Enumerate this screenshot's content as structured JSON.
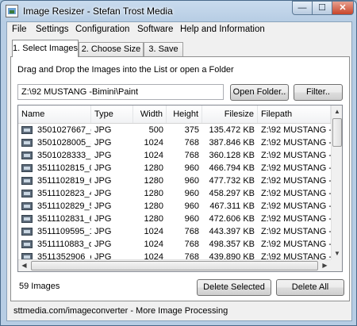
{
  "window": {
    "title": "Image Resizer - Stefan Trost Media",
    "min_glyph": "—",
    "max_glyph": "☐",
    "close_glyph": "✕"
  },
  "menu": [
    "File",
    "Settings",
    "Configuration",
    "Software",
    "Help and Information"
  ],
  "tabs": [
    "1. Select Images",
    "2. Choose Size",
    "3. Save"
  ],
  "hint": "Drag and Drop the Images into the List or open a Folder",
  "folder_path": "Z:\\92 MUSTANG -Bimini\\Paint",
  "buttons": {
    "open_folder": "Open Folder..",
    "filter": "Filter..",
    "delete_selected": "Delete Selected",
    "delete_all": "Delete All"
  },
  "columns": [
    "Name",
    "Type",
    "Width",
    "Height",
    "Filesize",
    "Filepath"
  ],
  "rows": [
    [
      "3501027667_d...",
      "JPG",
      "500",
      "375",
      "135.472 KB",
      "Z:\\92 MUSTANG -"
    ],
    [
      "3501028005_5...",
      "JPG",
      "1024",
      "768",
      "387.846 KB",
      "Z:\\92 MUSTANG -"
    ],
    [
      "3501028333_1...",
      "JPG",
      "1024",
      "768",
      "360.128 KB",
      "Z:\\92 MUSTANG -"
    ],
    [
      "3511102815_0...",
      "JPG",
      "1280",
      "960",
      "466.794 KB",
      "Z:\\92 MUSTANG -"
    ],
    [
      "3511102819_6...",
      "JPG",
      "1280",
      "960",
      "477.732 KB",
      "Z:\\92 MUSTANG -"
    ],
    [
      "3511102823_4...",
      "JPG",
      "1280",
      "960",
      "458.297 KB",
      "Z:\\92 MUSTANG -"
    ],
    [
      "3511102829_5...",
      "JPG",
      "1280",
      "960",
      "467.311 KB",
      "Z:\\92 MUSTANG -"
    ],
    [
      "3511102831_6...",
      "JPG",
      "1280",
      "960",
      "472.606 KB",
      "Z:\\92 MUSTANG -"
    ],
    [
      "3511109595_1...",
      "JPG",
      "1024",
      "768",
      "443.397 KB",
      "Z:\\92 MUSTANG -"
    ],
    [
      "3511110883_d...",
      "JPG",
      "1024",
      "768",
      "498.357 KB",
      "Z:\\92 MUSTANG -"
    ],
    [
      "3511352906_e...",
      "JPG",
      "1024",
      "768",
      "439.890 KB",
      "Z:\\92 MUSTANG -"
    ]
  ],
  "image_count": "59 Images",
  "footer": "sttmedia.com/imageconverter - More Image Processing"
}
